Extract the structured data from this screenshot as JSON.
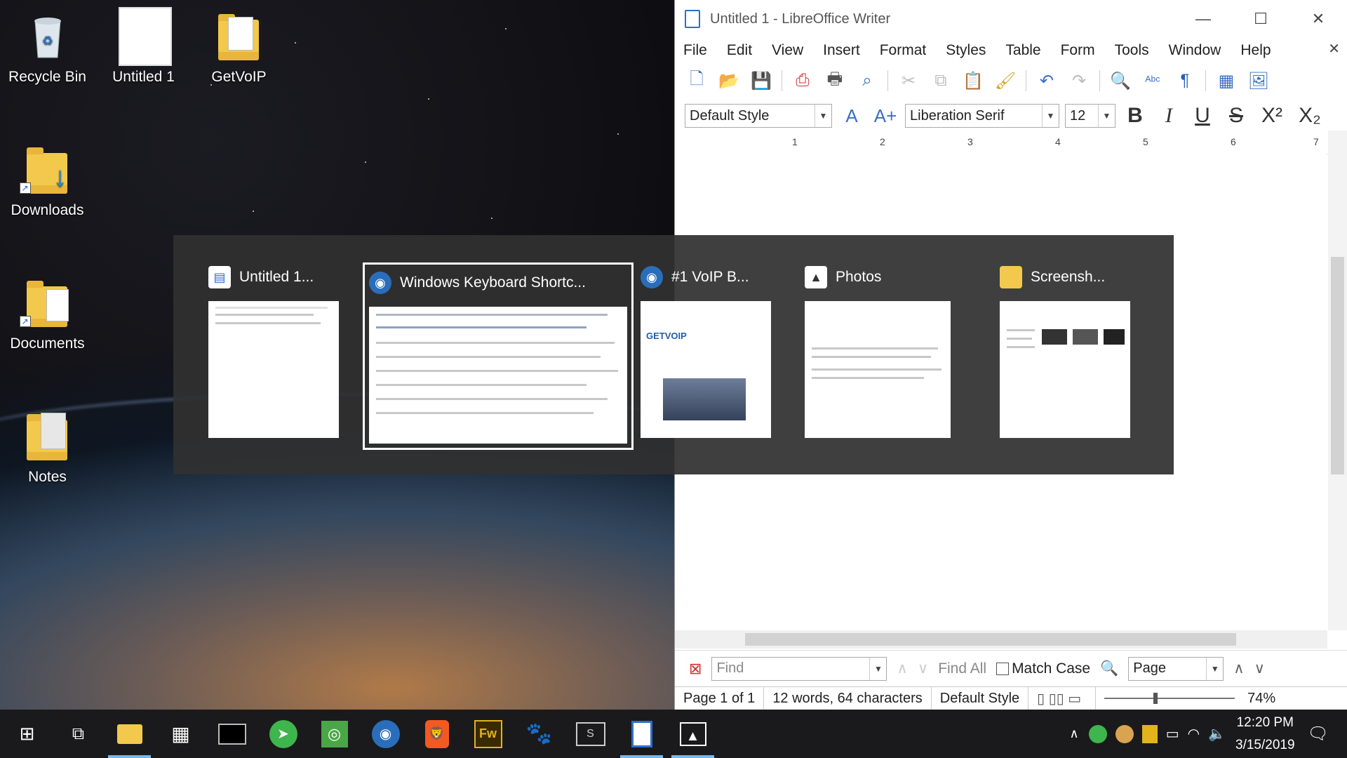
{
  "desktop": {
    "icons": [
      {
        "label": "Recycle Bin",
        "icon": "recycle-bin-icon"
      },
      {
        "label": "Untitled 1",
        "icon": "document-icon"
      },
      {
        "label": "GetVoIP",
        "icon": "folder-icon"
      },
      {
        "label": "Downloads",
        "icon": "downloads-folder-icon"
      },
      {
        "label": "Documents",
        "icon": "documents-folder-icon"
      },
      {
        "label": "Notes",
        "icon": "notes-folder-icon"
      }
    ]
  },
  "writer": {
    "title": "Untitled 1 - LibreOffice Writer",
    "menu": [
      "File",
      "Edit",
      "View",
      "Insert",
      "Format",
      "Styles",
      "Table",
      "Form",
      "Tools",
      "Window",
      "Help"
    ],
    "paragraph_style": "Default Style",
    "font_name": "Liberation Serif",
    "font_size": "12",
    "format": {
      "bold": "B",
      "italic": "I",
      "underline": "U",
      "strike": "S",
      "superscript": "X²",
      "subscript": "X₂"
    },
    "ruler": [
      "1",
      "2",
      "3",
      "4",
      "5",
      "6",
      "7"
    ],
    "find": {
      "placeholder": "Find",
      "find_all": "Find All",
      "match_case": "Match Case",
      "scope": "Page"
    },
    "status": {
      "page": "Page 1 of 1",
      "words": "12 words, 64 characters",
      "style": "Default Style",
      "zoom": "74%"
    }
  },
  "switcher": {
    "items": [
      {
        "title": "Untitled 1...",
        "icon": "writer-icon"
      },
      {
        "title": "Windows Keyboard Shortc...",
        "icon": "browser-icon",
        "selected": true
      },
      {
        "title": "#1 VoIP B...",
        "icon": "browser-icon"
      },
      {
        "title": "Photos",
        "icon": "photos-icon"
      },
      {
        "title": "Screensh...",
        "icon": "folder-icon"
      }
    ],
    "thumb_texts": {
      "getvoip": "GETVOIP"
    }
  },
  "taskbar": {
    "apps": [
      "start",
      "task-view",
      "file-explorer",
      "calculator",
      "terminal",
      "send",
      "rss",
      "browser",
      "brave",
      "fireworks",
      "gimp",
      "snagit",
      "writer",
      "photos"
    ],
    "clock": {
      "time": "12:20 PM",
      "date": "3/15/2019"
    }
  },
  "colors": {
    "accent": "#76b9ed",
    "taskbar": "#1a1a1c",
    "switcher": "#303030"
  }
}
